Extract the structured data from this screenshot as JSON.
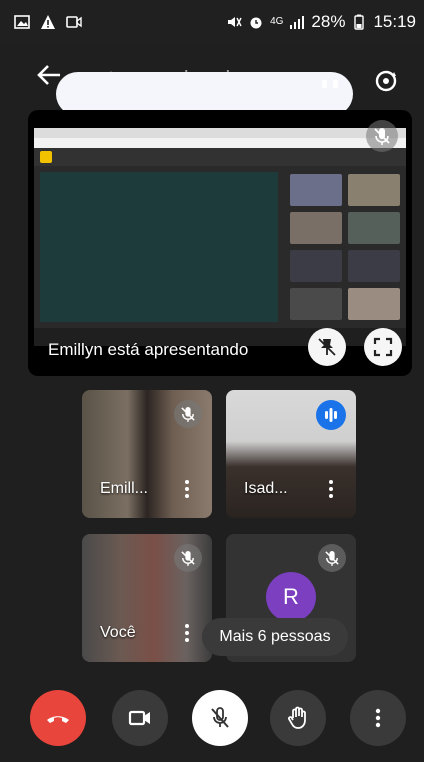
{
  "status_bar": {
    "percent": "28%",
    "time": "15:19",
    "signal": "4G"
  },
  "header": {
    "meeting_code": "tpr-pgmh-szh"
  },
  "presentation": {
    "label": "Emillyn está apresentando"
  },
  "participants": [
    {
      "name": "Emill...",
      "mic": "muted"
    },
    {
      "name": "Isad...",
      "mic": "speaking"
    },
    {
      "name": "Você",
      "mic": "muted"
    },
    {
      "name": "",
      "avatar_letter": "R",
      "mic": "muted"
    }
  ],
  "more_people": "Mais 6 pessoas",
  "controls": [
    {
      "action": "end-call",
      "icon": "phone-hangup-icon"
    },
    {
      "action": "camera",
      "icon": "video-camera-icon"
    },
    {
      "action": "microphone",
      "icon": "mic-off-icon"
    },
    {
      "action": "raise-hand",
      "icon": "hand-icon"
    },
    {
      "action": "more-options",
      "icon": "more-vert-icon"
    }
  ],
  "colors": {
    "end_call": "#e8453c",
    "speaking": "#1a73e8",
    "avatar_r": "#7b3fbf",
    "background": "#1f1f1f"
  }
}
